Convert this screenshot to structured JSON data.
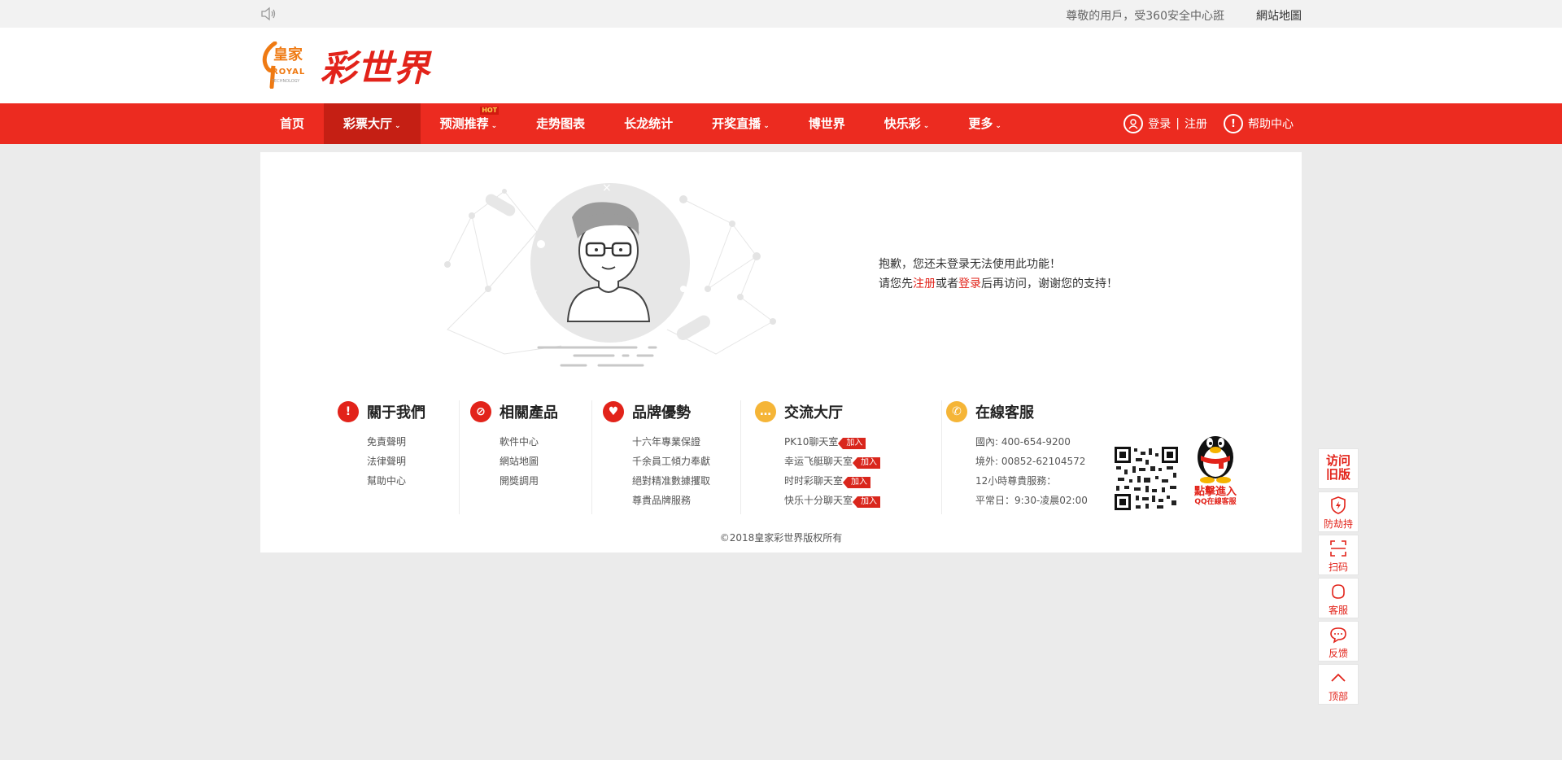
{
  "topbar": {
    "speaker_icon": "speaker-icon",
    "marquee": "尊敬的用戶，受360安全中心誑",
    "sitemap": "網站地圖"
  },
  "logo": {
    "royal": "皇家",
    "royal_en": "ROYAL",
    "tech": "TECHNOLOGY",
    "name": "彩世界"
  },
  "nav": {
    "items": [
      {
        "label": "首页",
        "caret": false
      },
      {
        "label": "彩票大厅",
        "caret": true
      },
      {
        "label": "预测推荐",
        "caret": true,
        "badge": "HOT"
      },
      {
        "label": "走势图表",
        "caret": false
      },
      {
        "label": "长龙统计",
        "caret": false
      },
      {
        "label": "开奖直播",
        "caret": true
      },
      {
        "label": "博世界",
        "caret": false
      },
      {
        "label": "快乐彩",
        "caret": true
      },
      {
        "label": "更多",
        "caret": true
      }
    ],
    "login": "登录",
    "separator": "|",
    "register": "注册",
    "help": "帮助中心"
  },
  "message": {
    "line1": "抱歉，您还未登录无法使用此功能！",
    "line2_pre": "请您先",
    "line2_register": "注册",
    "line2_mid": "或者",
    "line2_login": "登录",
    "line2_post": "后再访问，谢谢您的支持！"
  },
  "footer": {
    "about": {
      "title": "關于我們",
      "icon_color": "#e2231a",
      "items": [
        "免責聲明",
        "法律聲明",
        "幫助中心"
      ]
    },
    "products": {
      "title": "相關產品",
      "icon_color": "#e2231a",
      "items": [
        "軟件中心",
        "網站地圖",
        "開獎調用"
      ]
    },
    "brand": {
      "title": "品牌優勢",
      "icon_color": "#e2231a",
      "items": [
        "十六年專業保證",
        "千余員工傾力奉獻",
        "絕對精准數據攫取",
        "尊貴品牌服務"
      ]
    },
    "chat": {
      "title": "交流大厅",
      "icon_color": "#f5b537",
      "join": "加入",
      "items": [
        "PK10聊天室",
        "幸运飞艇聊天室",
        "时时彩聊天室",
        "快乐十分聊天室"
      ]
    },
    "service": {
      "title": "在線客服",
      "icon_color": "#f5b537",
      "items": [
        "國內: 400-654-9200",
        "境外: 00852-62104572",
        "12小時尊貴服務：",
        "平常日：9:30-凌晨02:00"
      ],
      "qq_line1": "點擊進入",
      "qq_line2": "QQ在線客服"
    }
  },
  "copyright": "©2018皇家彩世界版权所有",
  "side": {
    "old_version": "访问旧版",
    "items": [
      {
        "label": "防劫持",
        "icon": "shield-icon"
      },
      {
        "label": "扫码",
        "icon": "scan-icon"
      },
      {
        "label": "客服",
        "icon": "headset-icon"
      },
      {
        "label": "反馈",
        "icon": "chat-bubble-icon"
      },
      {
        "label": "顶部",
        "icon": "arrow-up-icon"
      }
    ]
  }
}
